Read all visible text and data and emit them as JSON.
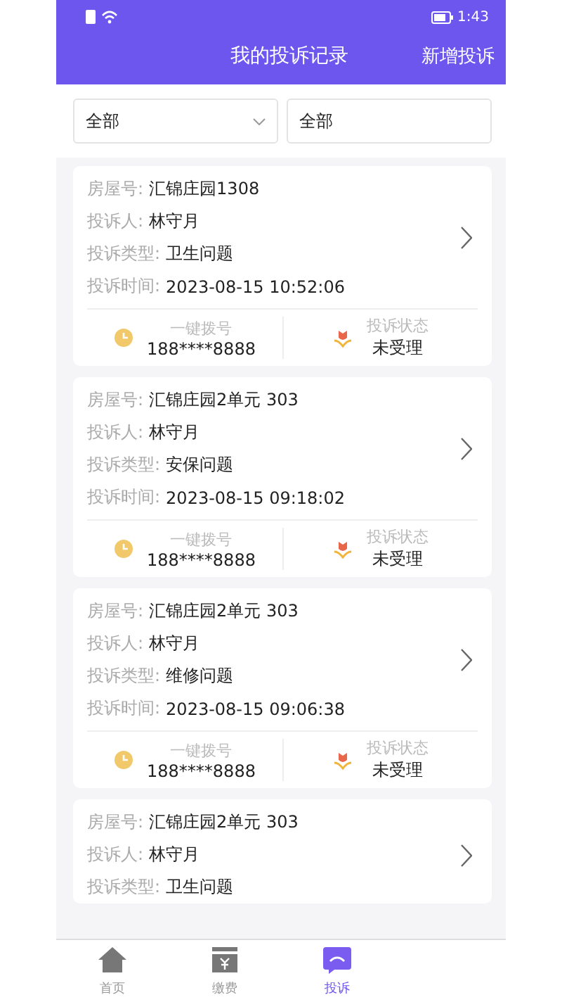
{
  "status_bar": {
    "time": "1:43"
  },
  "header": {
    "title": "我的投诉记录",
    "action": "新增投诉"
  },
  "filters": [
    {
      "kind": "dropdown",
      "value": "全部"
    },
    {
      "kind": "text",
      "value": "全部"
    }
  ],
  "records": [
    {
      "fields": [
        {
          "label": "房屋号:",
          "value": "汇锦庄园1308"
        },
        {
          "label": "投诉人:",
          "value": "林守月"
        },
        {
          "label": "投诉类型:",
          "value": "卫生问题"
        },
        {
          "label": "投诉时间:",
          "value": "2023-08-15 10:52:06"
        }
      ],
      "call_label": "一键拨号",
      "phone": "188****8888",
      "status_label": "投诉状态",
      "status": "未受理"
    },
    {
      "fields": [
        {
          "label": "房屋号:",
          "value": "汇锦庄园2单元 303"
        },
        {
          "label": "投诉人:",
          "value": "林守月"
        },
        {
          "label": "投诉类型:",
          "value": "安保问题"
        },
        {
          "label": "投诉时间:",
          "value": "2023-08-15 09:18:02"
        }
      ],
      "call_label": "一键拨号",
      "phone": "188****8888",
      "status_label": "投诉状态",
      "status": "未受理"
    },
    {
      "fields": [
        {
          "label": "房屋号:",
          "value": "汇锦庄园2单元 303"
        },
        {
          "label": "投诉人:",
          "value": "林守月"
        },
        {
          "label": "投诉类型:",
          "value": "维修问题"
        },
        {
          "label": "投诉时间:",
          "value": "2023-08-15 09:06:38"
        }
      ],
      "call_label": "一键拨号",
      "phone": "188****8888",
      "status_label": "投诉状态",
      "status": "未受理"
    },
    {
      "fields": [
        {
          "label": "房屋号:",
          "value": "汇锦庄园2单元 303"
        },
        {
          "label": "投诉人:",
          "value": "林守月"
        },
        {
          "label": "投诉类型:",
          "value": "卫生问题"
        }
      ]
    }
  ],
  "tabs": [
    {
      "kind": "home",
      "label": "首页",
      "selected": false
    },
    {
      "kind": "pay",
      "label": "缴费",
      "selected": false
    },
    {
      "kind": "complaint",
      "label": "投诉",
      "selected": true
    }
  ]
}
